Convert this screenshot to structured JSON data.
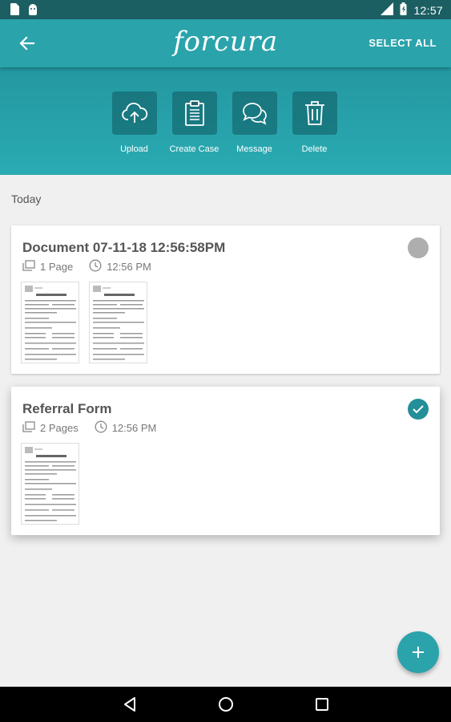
{
  "status_bar": {
    "time": "12:57",
    "icons": [
      "sim-card-icon",
      "android-icon",
      "signal-icon",
      "battery-icon"
    ]
  },
  "app_bar": {
    "brand": "forcura",
    "select_all": "SELECT ALL",
    "back_icon": "arrow-left-icon"
  },
  "actions": [
    {
      "label": "Upload",
      "icon": "cloud-upload-icon"
    },
    {
      "label": "Create Case",
      "icon": "clipboard-icon"
    },
    {
      "label": "Message",
      "icon": "chat-bubbles-icon"
    },
    {
      "label": "Delete",
      "icon": "trash-icon"
    }
  ],
  "section": {
    "title": "Today"
  },
  "documents": [
    {
      "title": "Document 07-11-18 12:56:58PM",
      "pages": "1 Page",
      "time": "12:56 PM",
      "selected": false,
      "thumbnail_count": 2
    },
    {
      "title": "Referral Form",
      "pages": "2 Pages",
      "time": "12:56 PM",
      "selected": true,
      "thumbnail_count": 1
    }
  ],
  "fab": {
    "icon": "plus-icon"
  },
  "colors": {
    "accent": "#2aa3ab",
    "status_bar": "#1c5f63",
    "selected_check": "#238f98",
    "unselected_dot": "#aeaeae",
    "background": "#f1f0f0"
  }
}
